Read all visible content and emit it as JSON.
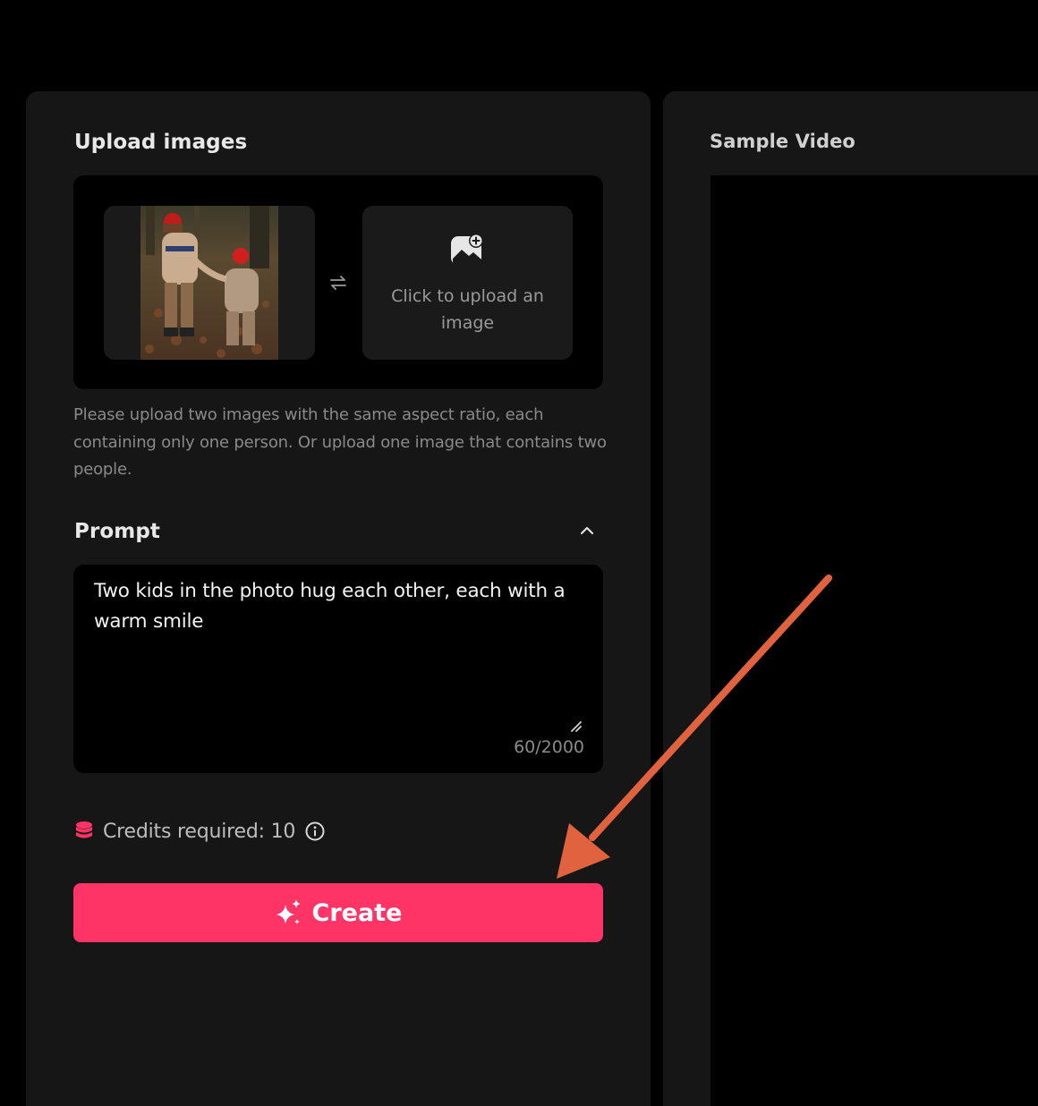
{
  "upload": {
    "title": "Upload images",
    "upload_prompt": "Click to upload an image",
    "hint": "Please upload two images with the same aspect ratio, each containing only one person. Or upload one image that contains two people."
  },
  "prompt": {
    "title": "Prompt",
    "text": "Two kids in the photo hug each other, each with a warm smile",
    "char_count": "60/2000"
  },
  "credits": {
    "text": "Credits required: 10"
  },
  "create_button": {
    "label": "Create"
  },
  "sample": {
    "title": "Sample Video"
  },
  "colors": {
    "accent": "#fe3366",
    "panel": "#161616",
    "annotation_arrow": "#e0623f"
  }
}
